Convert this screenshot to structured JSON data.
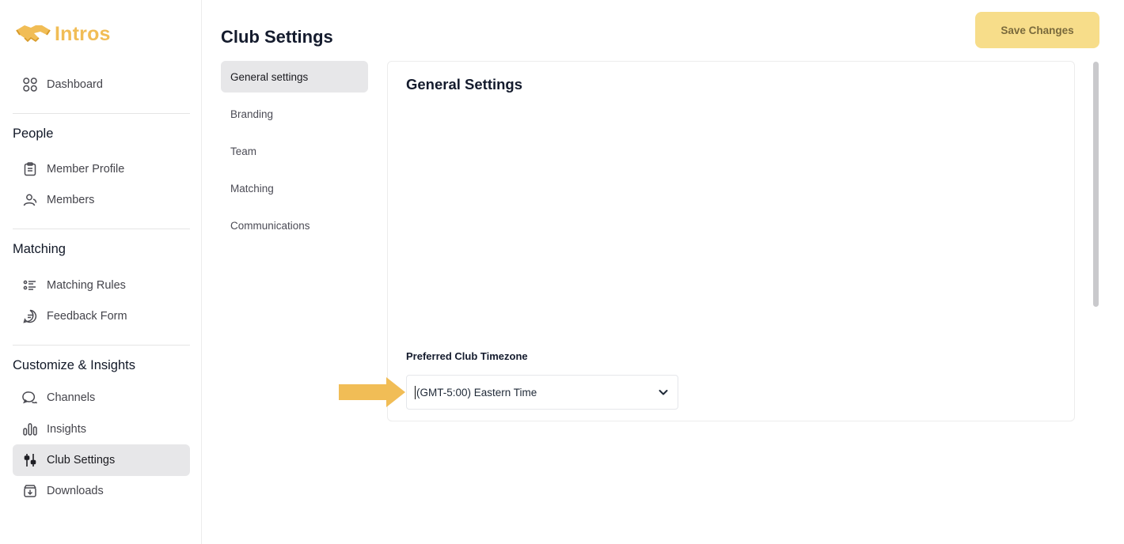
{
  "brand": {
    "name": "Intros",
    "color": "#f1bd56"
  },
  "sidebar": {
    "top_items": [
      {
        "label": "Dashboard",
        "icon": "dashboard-grid-icon"
      }
    ],
    "sections": [
      {
        "title": "People",
        "items": [
          {
            "label": "Member Profile",
            "icon": "clipboard-icon"
          },
          {
            "label": "Members",
            "icon": "users-icon"
          }
        ]
      },
      {
        "title": "Matching",
        "items": [
          {
            "label": "Matching Rules",
            "icon": "list-rules-icon"
          },
          {
            "label": "Feedback Form",
            "icon": "feedback-icon"
          }
        ]
      },
      {
        "title": "Customize & Insights",
        "items": [
          {
            "label": "Channels",
            "icon": "chat-bubbles-icon"
          },
          {
            "label": "Insights",
            "icon": "bar-chart-icon"
          },
          {
            "label": "Club Settings",
            "icon": "sliders-icon",
            "active": true
          },
          {
            "label": "Downloads",
            "icon": "download-box-icon"
          }
        ]
      }
    ]
  },
  "header": {
    "title": "Club Settings",
    "save_label": "Save Changes",
    "save_color": "#f7dd8a"
  },
  "subnav": {
    "items": [
      {
        "label": "General settings",
        "active": true
      },
      {
        "label": "Branding"
      },
      {
        "label": "Team"
      },
      {
        "label": "Matching"
      },
      {
        "label": "Communications"
      }
    ]
  },
  "card": {
    "title": "General Settings",
    "timezone": {
      "label": "Preferred Club Timezone",
      "value": "(GMT-5:00) Eastern Time"
    }
  }
}
